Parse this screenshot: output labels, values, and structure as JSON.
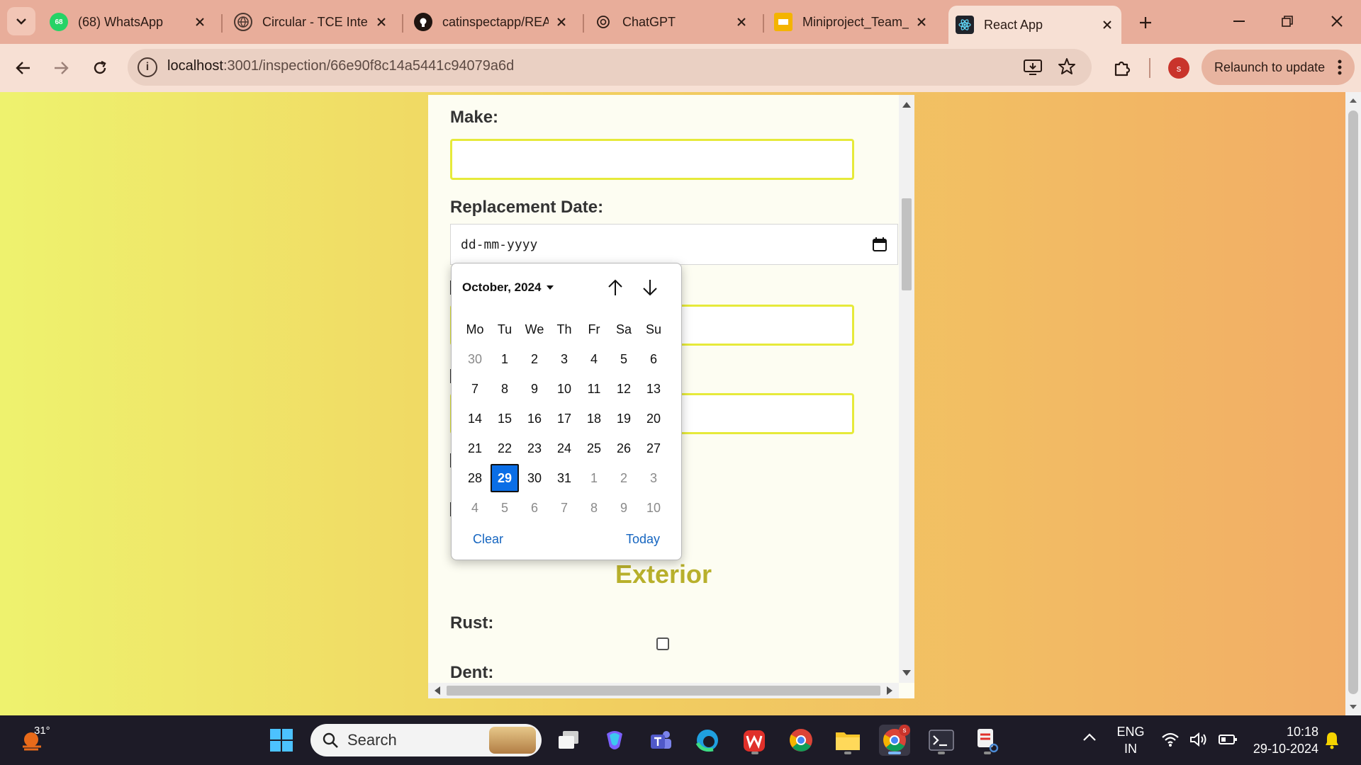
{
  "browser": {
    "tabs": [
      {
        "title": "(68) WhatsApp",
        "badge": "68",
        "icon": "whatsapp-icon"
      },
      {
        "title": "Circular - TCE Inter",
        "icon": "globe-icon"
      },
      {
        "title": "catinspectapp/REA",
        "icon": "github-icon"
      },
      {
        "title": "ChatGPT",
        "icon": "chatgpt-icon"
      },
      {
        "title": "Miniproject_Team_",
        "icon": "slides-icon"
      },
      {
        "title": "React App",
        "icon": "react-icon"
      }
    ],
    "url_host": "localhost",
    "url_rest": ":3001/inspection/66e90f8c14a5441c94079a6d",
    "profile_initial": "s",
    "relaunch_label": "Relaunch to update"
  },
  "form": {
    "make_label": "Make:",
    "replacement_date_label": "Replacement Date:",
    "date_placeholder": "dd-mm-yyyy",
    "section_exterior": "Exterior",
    "rust_label": "Rust:",
    "dent_label": "Dent:"
  },
  "datepicker": {
    "month_label": "October, 2024",
    "weekdays": [
      "Mo",
      "Tu",
      "We",
      "Th",
      "Fr",
      "Sa",
      "Su"
    ],
    "days": [
      {
        "d": "30",
        "muted": true
      },
      {
        "d": "1"
      },
      {
        "d": "2"
      },
      {
        "d": "3"
      },
      {
        "d": "4"
      },
      {
        "d": "5"
      },
      {
        "d": "6"
      },
      {
        "d": "7"
      },
      {
        "d": "8"
      },
      {
        "d": "9"
      },
      {
        "d": "10"
      },
      {
        "d": "11"
      },
      {
        "d": "12"
      },
      {
        "d": "13"
      },
      {
        "d": "14"
      },
      {
        "d": "15"
      },
      {
        "d": "16"
      },
      {
        "d": "17"
      },
      {
        "d": "18"
      },
      {
        "d": "19"
      },
      {
        "d": "20"
      },
      {
        "d": "21"
      },
      {
        "d": "22"
      },
      {
        "d": "23"
      },
      {
        "d": "24"
      },
      {
        "d": "25"
      },
      {
        "d": "26"
      },
      {
        "d": "27"
      },
      {
        "d": "28"
      },
      {
        "d": "29",
        "selected": true
      },
      {
        "d": "30"
      },
      {
        "d": "31"
      },
      {
        "d": "1",
        "muted": true
      },
      {
        "d": "2",
        "muted": true
      },
      {
        "d": "3",
        "muted": true
      },
      {
        "d": "4",
        "muted": true
      },
      {
        "d": "5",
        "muted": true
      },
      {
        "d": "6",
        "muted": true
      },
      {
        "d": "7",
        "muted": true
      },
      {
        "d": "8",
        "muted": true
      },
      {
        "d": "9",
        "muted": true
      },
      {
        "d": "10",
        "muted": true
      }
    ],
    "clear_label": "Clear",
    "today_label": "Today"
  },
  "taskbar": {
    "weather_temp": "31°",
    "search_label": "Search",
    "lang_line1": "ENG",
    "lang_line2": "IN",
    "time": "10:18",
    "date": "29-10-2024",
    "chrome_badge": "s"
  },
  "colors": {
    "accent_blue": "#0a6ee6",
    "input_border": "#e6ea3a",
    "section_title": "#b8b02c"
  }
}
